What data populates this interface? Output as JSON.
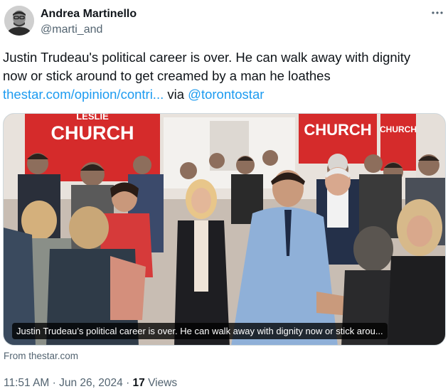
{
  "author": {
    "name": "Andrea Martinello",
    "handle": "@marti_and"
  },
  "tweet": {
    "text_line1": "Justin Trudeau's political career is over. He can walk away with dignity",
    "text_line2": "now or stick around to get creamed by a man he loathes",
    "link": "thestar.com/opinion/contri...",
    "via": " via ",
    "mention": "@torontostar"
  },
  "card": {
    "caption": "Justin Trudeau’s political career is over. He can walk away with dignity now or stick arou...",
    "sign_left": "CHURCH",
    "sign_left_top": "LESLIE",
    "sign_right": "CHURCH",
    "sign_right_small": "CHURCH",
    "source": "From thestar.com"
  },
  "meta": {
    "time": "11:51 AM",
    "sep1": " · ",
    "date": "Jun 26, 2024",
    "sep2": " · ",
    "views_count": "17",
    "views_label": " Views"
  },
  "icons": {
    "more": "more-horizontal-icon"
  },
  "colors": {
    "link": "#1d9bf0",
    "secondary_text": "#536471",
    "primary_text": "#0f1419",
    "sign_red": "#d52b2b"
  }
}
